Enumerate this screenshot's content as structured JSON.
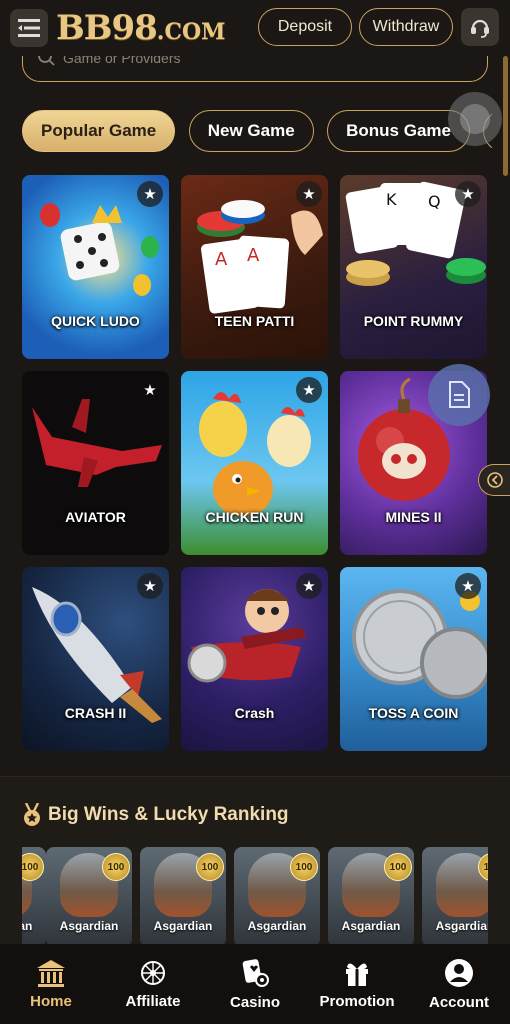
{
  "header": {
    "logo_main": "BB98",
    "logo_suffix": ".COM",
    "deposit_label": "Deposit",
    "withdraw_label": "Withdraw"
  },
  "search": {
    "placeholder": "Game or Providers"
  },
  "tabs": [
    {
      "label": "Popular Game",
      "active": true
    },
    {
      "label": "New Game",
      "active": false
    },
    {
      "label": "Bonus Game",
      "active": false
    },
    {
      "label": "F",
      "active": false
    }
  ],
  "games": [
    {
      "title": "QUICK LUDO"
    },
    {
      "title": "TEEN PATTI"
    },
    {
      "title": "POINT RUMMY"
    },
    {
      "title": "AVIATOR"
    },
    {
      "title": "CHICKEN RUN"
    },
    {
      "title": "MINES II"
    },
    {
      "title": "CRASH II"
    },
    {
      "title": "Crash"
    },
    {
      "title": "TOSS A COIN"
    }
  ],
  "ranking": {
    "title": "Big Wins & Lucky Ranking",
    "items": [
      {
        "name": "Asgardian",
        "badge": "100"
      },
      {
        "name": "Asgardian",
        "badge": "100"
      },
      {
        "name": "Asgardian",
        "badge": "100"
      },
      {
        "name": "Asgardian",
        "badge": "100"
      },
      {
        "name": "Asgardian",
        "badge": "100"
      }
    ]
  },
  "nav": [
    {
      "label": "Home",
      "icon": "home-icon",
      "active": true
    },
    {
      "label": "Affiliate",
      "icon": "network-icon",
      "active": false
    },
    {
      "label": "Casino",
      "icon": "casino-cards-icon",
      "active": false
    },
    {
      "label": "Promotion",
      "icon": "gift-icon",
      "active": false
    },
    {
      "label": "Account",
      "icon": "user-icon",
      "active": false
    }
  ],
  "colors": {
    "accent_gold": "#c9a35e",
    "active_tab": "#e4c27b",
    "background": "#1b1714"
  }
}
